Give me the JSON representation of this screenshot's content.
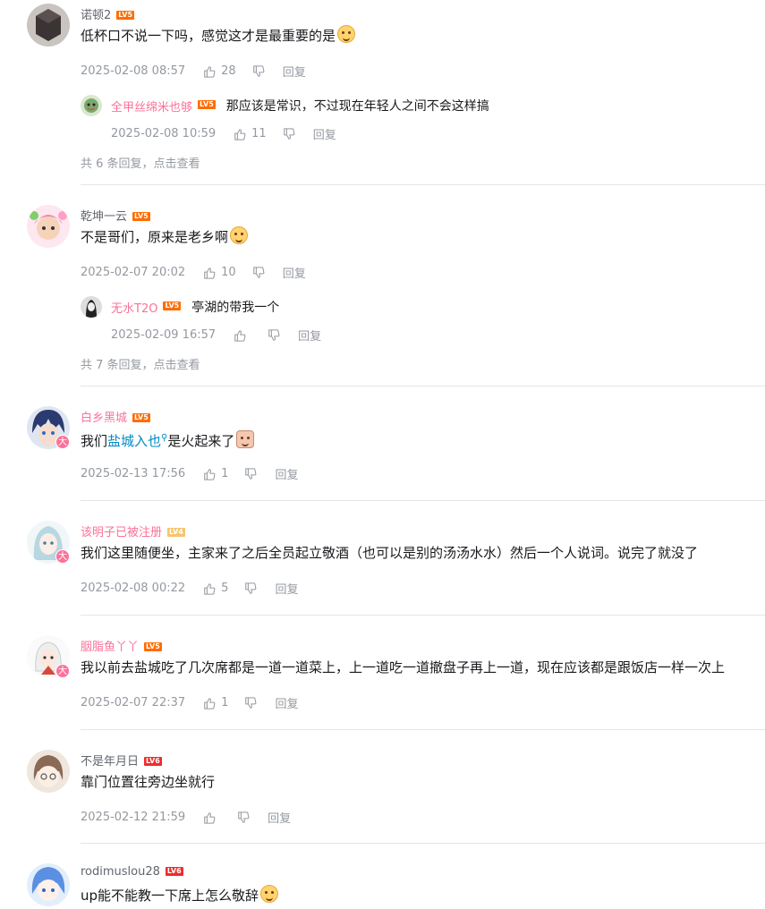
{
  "comments": [
    {
      "username": "诺顿2",
      "level": "LV5",
      "text": "低杯口不说一下吗，感觉这才是最重要的是",
      "time": "2025-02-08 08:57",
      "likes": "28",
      "reply_label": "回复",
      "sub_reply": {
        "username": "全甲丝绵米也够",
        "level": "LV5",
        "text": "那应该是常识，不过现在年轻人之间不会这样搞",
        "time": "2025-02-08 10:59",
        "likes": "11",
        "reply_label": "回复"
      },
      "more": "共 6 条回复，点击查看"
    },
    {
      "username": "乾坤一云",
      "level": "LV5",
      "text": "不是哥们，原来是老乡啊",
      "time": "2025-02-07 20:02",
      "likes": "10",
      "reply_label": "回复",
      "sub_reply": {
        "username": "无水T2O",
        "level": "LV5",
        "text": "亭湖的带我一个",
        "time": "2025-02-09 16:57",
        "likes": "",
        "reply_label": "回复"
      },
      "more": "共 7 条回复，点击查看"
    },
    {
      "username": "白乡黑城",
      "level": "LV5",
      "badge": "大",
      "text_before": "我们",
      "text_link": "盐城入也",
      "text_after": "是火起来了",
      "time": "2025-02-13 17:56",
      "likes": "1",
      "reply_label": "回复"
    },
    {
      "username": "该明子已被注册",
      "level": "LV4",
      "badge": "大",
      "text": "我们这里随便坐，主家来了之后全员起立敬酒（也可以是别的汤汤水水）然后一个人说词。说完了就没了",
      "time": "2025-02-08 00:22",
      "likes": "5",
      "reply_label": "回复"
    },
    {
      "username": "胭脂鱼丫丫",
      "level": "LV5",
      "badge": "大",
      "text": "我以前去盐城吃了几次席都是一道一道菜上，上一道吃一道撤盘子再上一道，现在应该都是跟饭店一样一次上",
      "time": "2025-02-07 22:37",
      "likes": "1",
      "reply_label": "回复"
    },
    {
      "username": "不是年月日",
      "level": "LV6",
      "text": "靠门位置往旁边坐就行",
      "time": "2025-02-12 21:59",
      "likes": "",
      "reply_label": "回复"
    },
    {
      "username": "rodimuslou28",
      "level": "LV6",
      "text": "up能不能教一下席上怎么敬辞",
      "time": "",
      "likes": "",
      "reply_label": ""
    }
  ],
  "colors": {
    "lv4": "#f7a54a",
    "lv5": "#ff6c00",
    "lv6": "#ee2c2c",
    "pink": "#fb7299",
    "link": "#008ac5"
  }
}
